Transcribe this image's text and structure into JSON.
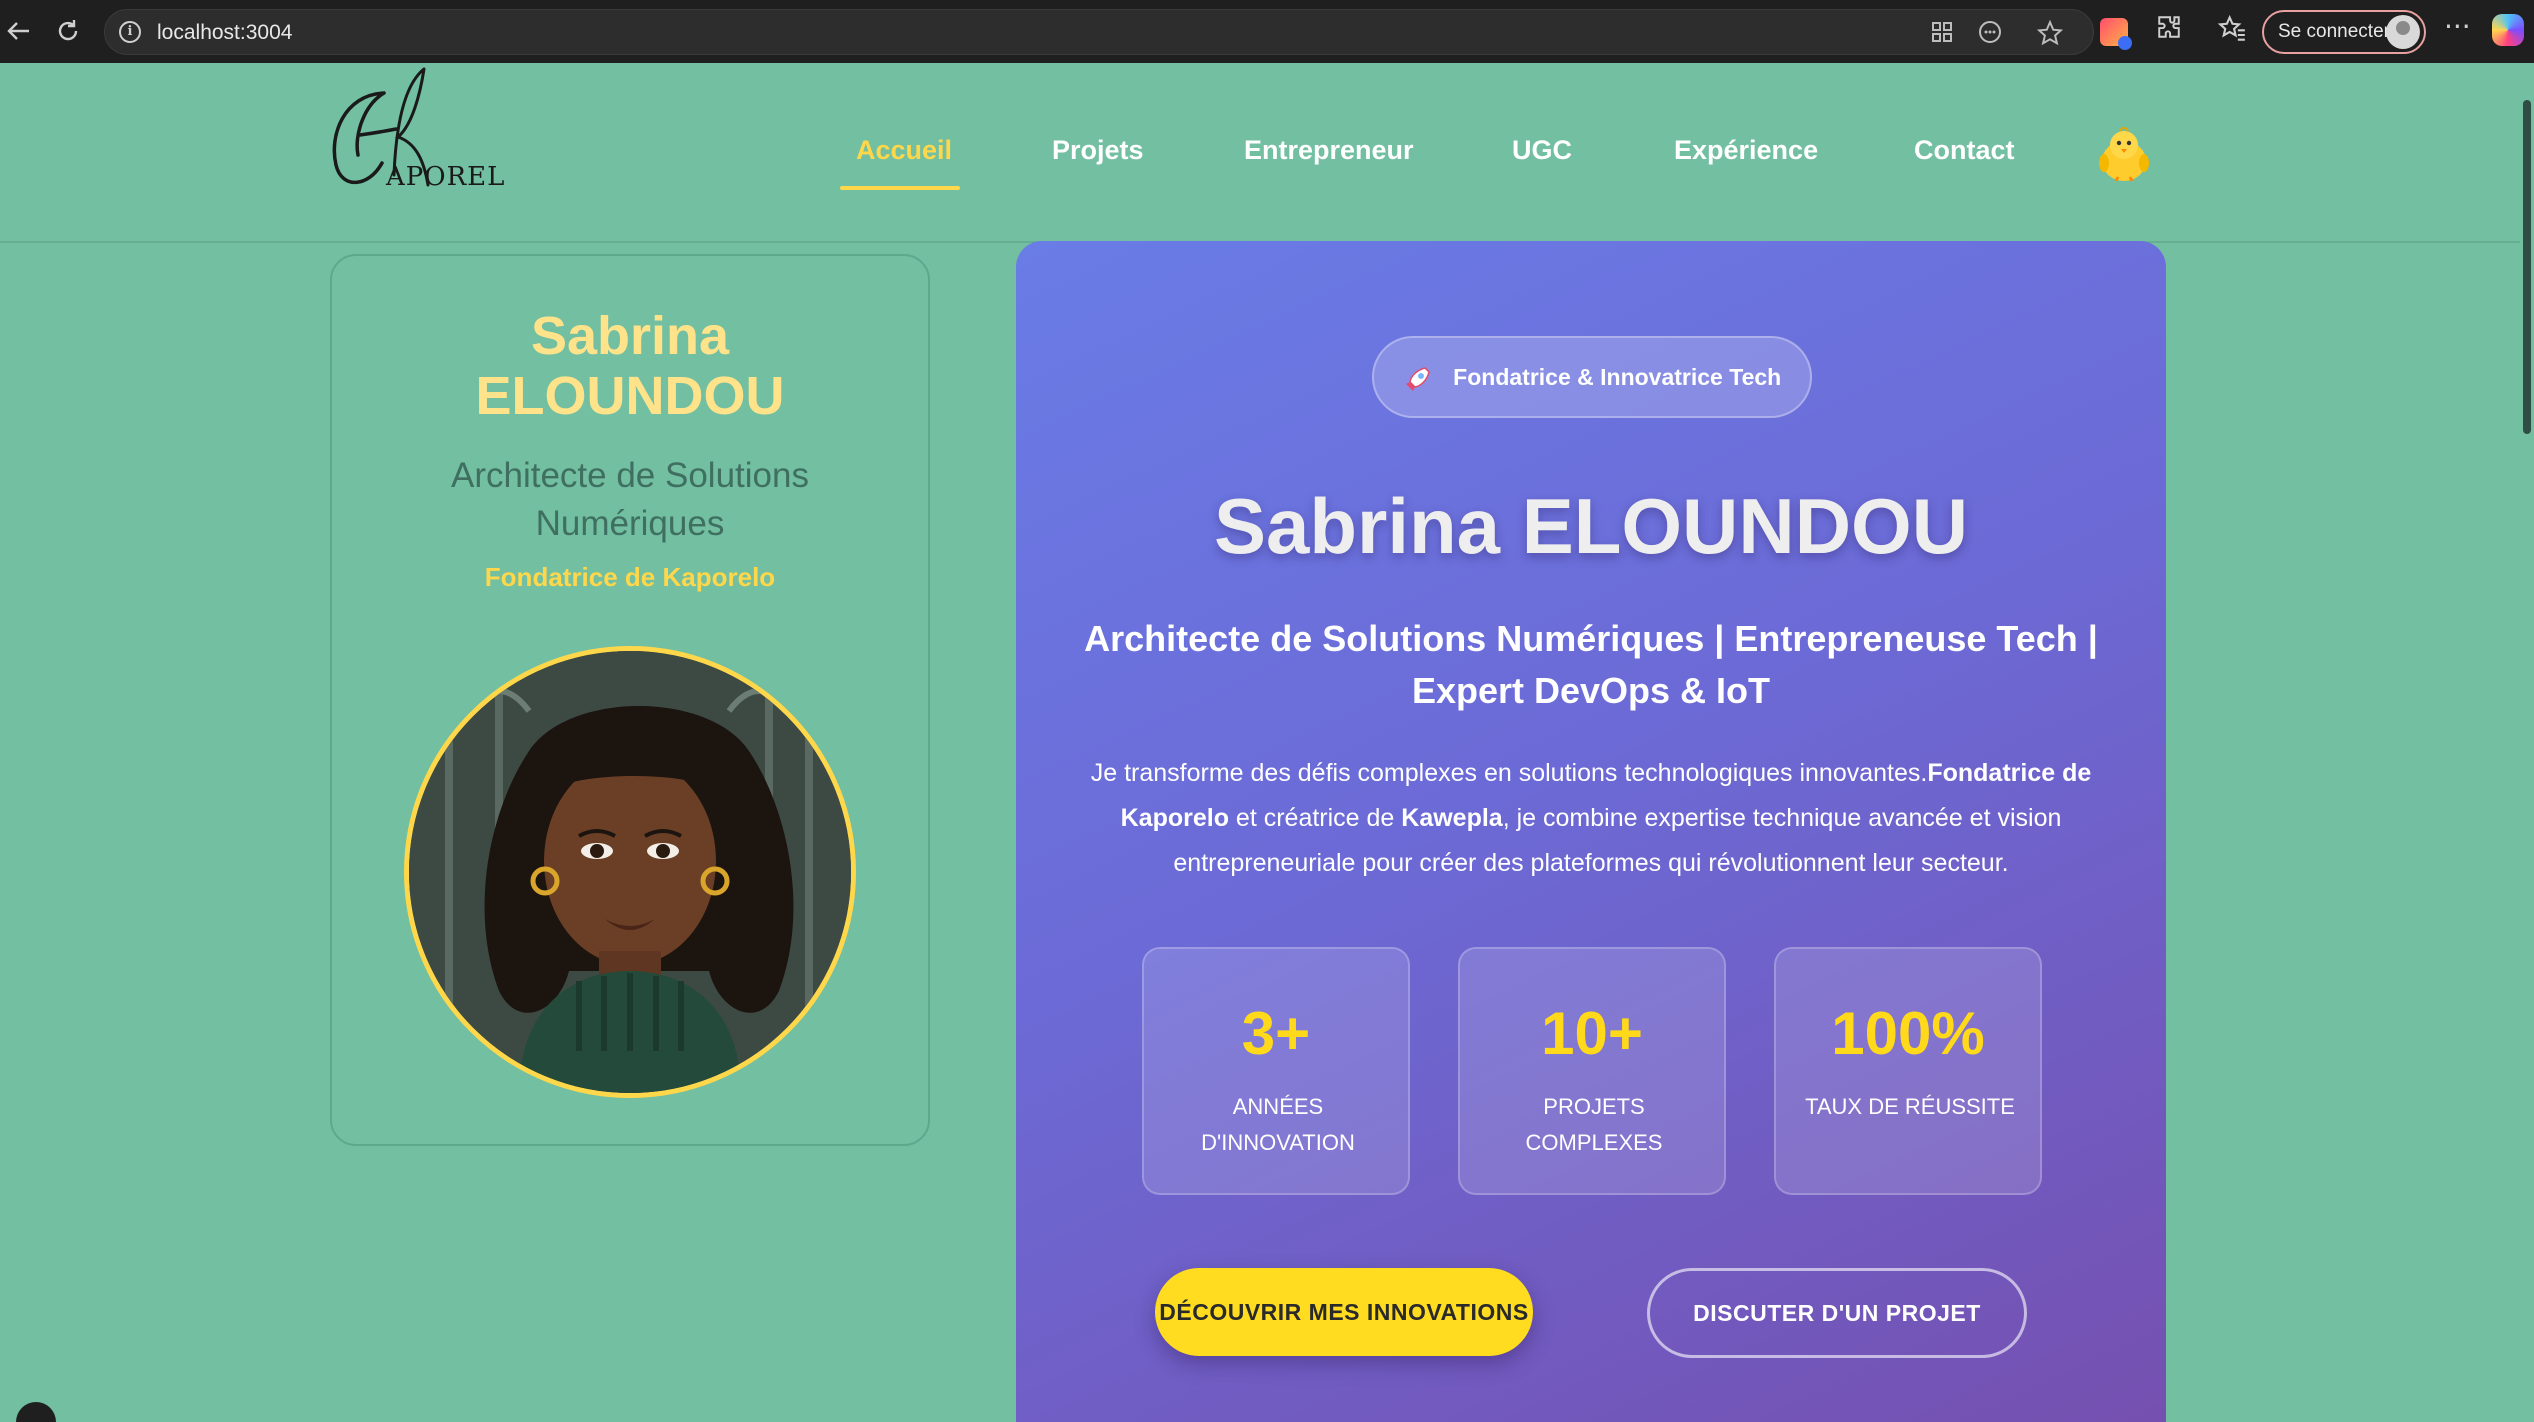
{
  "browser": {
    "url": "localhost:3004",
    "signin_label": "Se connecter",
    "icons": [
      "back-arrow-icon",
      "reload-icon",
      "info-icon",
      "apps-icon",
      "reader-icon",
      "star-icon",
      "extension-icon",
      "puzzle-icon",
      "favorites-icon",
      "more-icon",
      "copilot-icon"
    ]
  },
  "header": {
    "logo_text": "Kaporelo",
    "nav": [
      {
        "label": "Accueil",
        "active": true
      },
      {
        "label": "Projets",
        "active": false
      },
      {
        "label": "Entrepreneur",
        "active": false
      },
      {
        "label": "UGC",
        "active": false
      },
      {
        "label": "Expérience",
        "active": false
      },
      {
        "label": "Contact",
        "active": false
      }
    ],
    "mascot_icon": "chick-icon",
    "accent_color": "#ffd74a"
  },
  "profile": {
    "name_line1": "Sabrina",
    "name_line2": "ELOUNDOU",
    "role_line1": "Architecte de Solutions",
    "role_line2": "Numériques",
    "founder": "Fondatrice de Kaporelo"
  },
  "hero": {
    "badge_icon": "rocket-icon",
    "badge": "Fondatrice & Innovatrice Tech",
    "title": "Sabrina ELOUNDOU",
    "subtitle_line1": "Architecte de Solutions Numériques | Entrepreneuse Tech |",
    "subtitle_line2": "Expert DevOps & IoT",
    "desc_part1": "Je transforme des défis complexes en solutions technologiques innovantes.",
    "desc_bold1": "Fondatrice de Kaporelo",
    "desc_part2": " et créatrice de ",
    "desc_bold2": "Kawepla",
    "desc_part3": ", je combine expertise technique avancée et vision entrepreneuriale pour créer des plateformes qui révolutionnent leur secteur.",
    "stats": [
      {
        "value": "3+",
        "label": "Années d'innovation"
      },
      {
        "value": "10+",
        "label": "Projets complexes"
      },
      {
        "value": "100%",
        "label": "Taux de réussite"
      }
    ],
    "cta_primary": "DÉCOUVRIR MES INNOVATIONS",
    "cta_secondary": "DISCUTER D'UN PROJET",
    "gradient": [
      "#6a7ce6",
      "#7550b0"
    ]
  }
}
